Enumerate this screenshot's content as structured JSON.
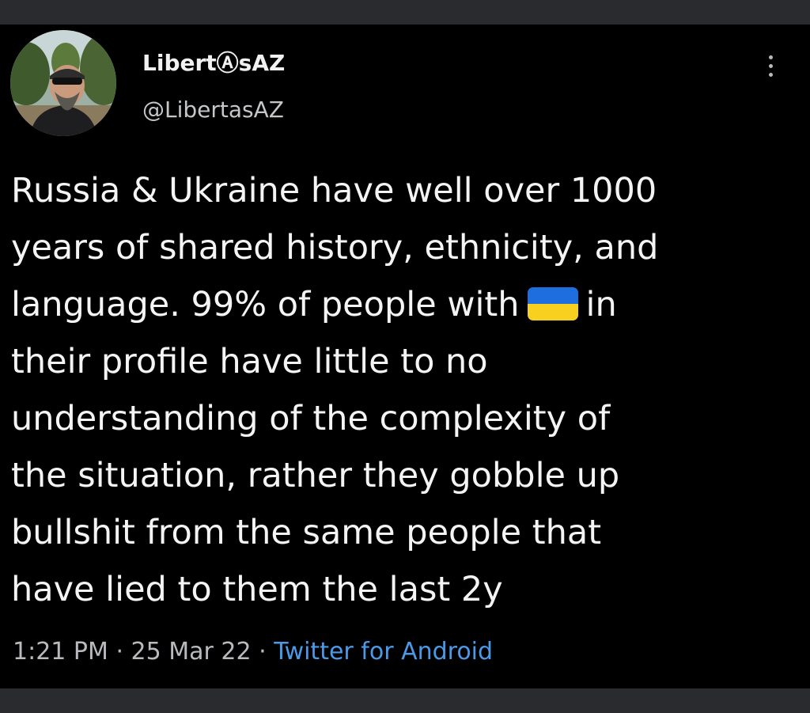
{
  "tweet": {
    "display_name": "LibertⒶsAZ",
    "handle": "@LibertasAZ",
    "body_lines": [
      "Russia & Ukraine have well over 1000",
      "years of shared history, ethnicity, and",
      "language. 99% of people with",
      "in",
      "their profile have little to no",
      "understanding of the complexity of",
      "the situation, rather they gobble up",
      "bullshit from the same people that",
      "have lied to them the last 2y"
    ],
    "time": "1:21 PM",
    "separator": "·",
    "date": "25 Mar 22",
    "source": "Twitter for Android"
  },
  "icons": {
    "more": "vertical-ellipsis-icon",
    "flag": "ukraine-flag-emoji"
  },
  "colors": {
    "background": "#000000",
    "frame_strip": "#2a2b2f",
    "text": "#f4f4f4",
    "muted": "#b8babd",
    "link": "#4a9ae8",
    "flag_blue": "#1f6ee0",
    "flag_yellow": "#f8d120"
  }
}
